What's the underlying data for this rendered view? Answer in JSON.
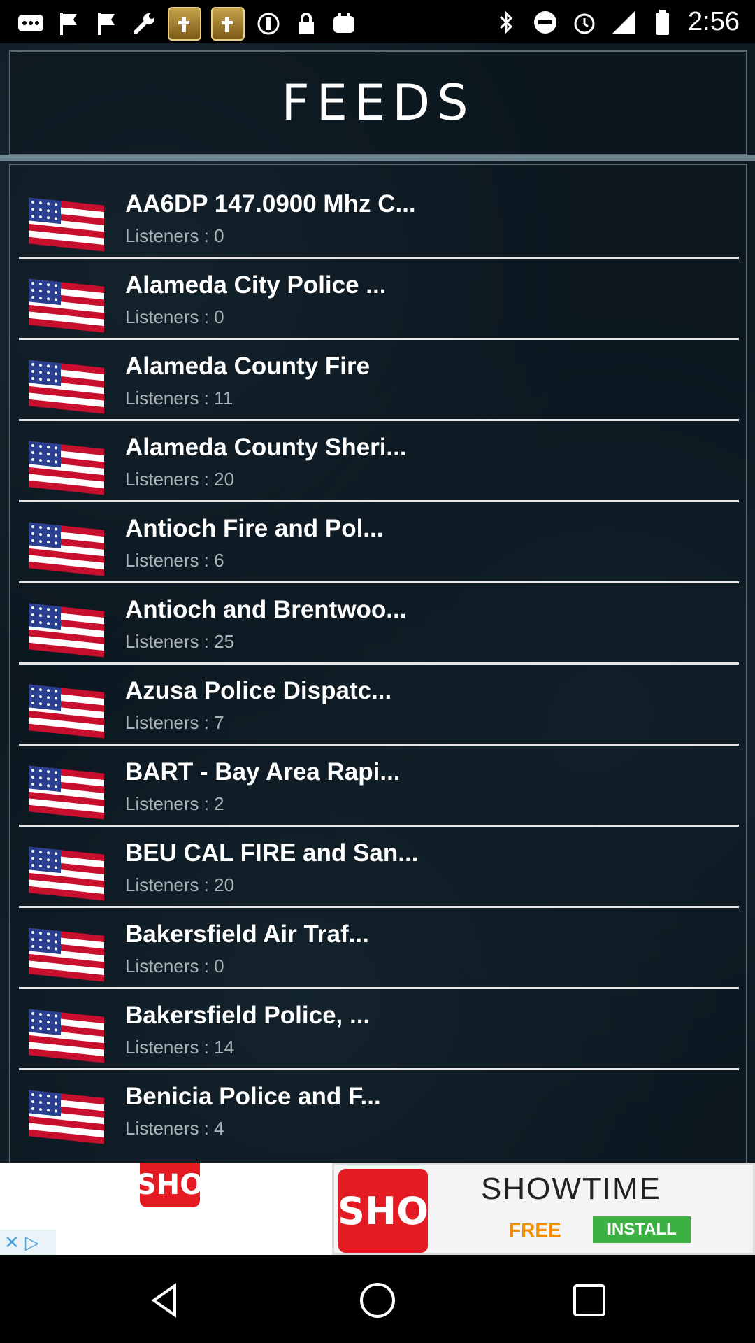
{
  "status_bar": {
    "time": "2:56"
  },
  "header": {
    "title": "FEEDS"
  },
  "feeds": [
    {
      "title": "AA6DP 147.0900 Mhz C...",
      "listeners": "Listeners : 0"
    },
    {
      "title": "Alameda City Police ...",
      "listeners": "Listeners : 0"
    },
    {
      "title": "Alameda County Fire",
      "listeners": "Listeners : 11"
    },
    {
      "title": "Alameda County Sheri...",
      "listeners": "Listeners : 20"
    },
    {
      "title": "Antioch Fire and Pol...",
      "listeners": "Listeners : 6"
    },
    {
      "title": "Antioch and Brentwoo...",
      "listeners": "Listeners : 25"
    },
    {
      "title": "Azusa Police Dispatc...",
      "listeners": "Listeners : 7"
    },
    {
      "title": "BART - Bay Area Rapi...",
      "listeners": "Listeners : 2"
    },
    {
      "title": "BEU CAL FIRE and San...",
      "listeners": "Listeners : 20"
    },
    {
      "title": "Bakersfield Air Traf...",
      "listeners": "Listeners : 0"
    },
    {
      "title": "Bakersfield Police, ...",
      "listeners": "Listeners : 14"
    },
    {
      "title": "Benicia Police and F...",
      "listeners": "Listeners : 4"
    }
  ],
  "ad": {
    "logo_small": "SHO",
    "logo_big": "SHO",
    "brand": "SHOWTIME",
    "free_label": "FREE",
    "install_label": "INSTALL"
  },
  "colors": {
    "background": "#0e1a22",
    "divider": "#e6e6e6",
    "subtitle": "#a9b3b8",
    "ad_red": "#e41b23",
    "install_green": "#3cb043"
  }
}
